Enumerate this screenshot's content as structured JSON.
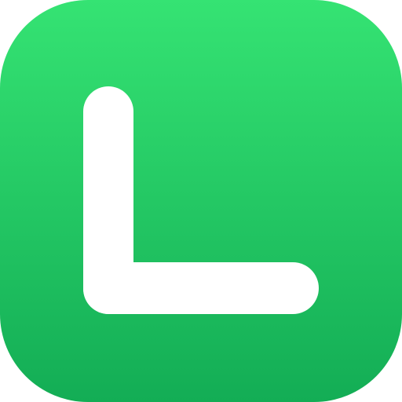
{
  "app_icon": {
    "icon": "letter-l-icon",
    "colors": {
      "gradient_top": "#35e373",
      "gradient_bottom": "#13ad55",
      "glyph": "#ffffff"
    }
  }
}
